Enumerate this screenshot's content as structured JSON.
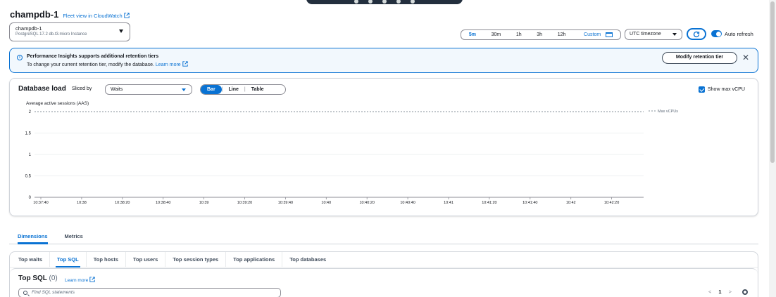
{
  "header": {
    "db_title": "champdb-1",
    "fleet_link": "Fleet view in CloudWatch",
    "instance_select": {
      "name": "champdb-1",
      "meta": "PostgreSQL  17.2  db.t3.micro  Instance"
    }
  },
  "time_range": {
    "options": [
      "5m",
      "30m",
      "1h",
      "3h",
      "12h"
    ],
    "selected": "5m",
    "custom_label": "Custom",
    "timezone": "UTC timezone",
    "auto_refresh_label": "Auto refresh",
    "auto_refresh_on": true
  },
  "alert": {
    "title": "Performance Insights supports additional retention tiers",
    "body": "To change your current retention tier, modify the database.",
    "learn_more": "Learn more",
    "button": "Modify retention tier",
    "close": "✕"
  },
  "load_panel": {
    "title": "Database load",
    "sliced_label": "Sliced by",
    "sliced_value": "Waits",
    "view_options": [
      "Bar",
      "Line",
      "Table"
    ],
    "view_selected": "Bar",
    "show_max_vcpu_label": "Show max vCPU",
    "show_max_vcpu_checked": true
  },
  "chart_data": {
    "type": "bar",
    "ylabel": "Average active sessions (AAS)",
    "ylim": [
      0,
      2
    ],
    "yticks": [
      "0",
      "0.5",
      "1",
      "1.5",
      "2"
    ],
    "categories": [
      "10:37:40",
      "10:38",
      "10:38:20",
      "10:38:40",
      "10:39",
      "10:39:20",
      "10:39:40",
      "10:40",
      "10:40:20",
      "10:40:40",
      "10:41",
      "10:41:20",
      "10:41:40",
      "10:42",
      "10:42:20"
    ],
    "series": [],
    "max_vcpu": 2,
    "legend": [
      {
        "name": "Max vCPUs",
        "style": "dashed"
      }
    ],
    "legend_position": "top-right",
    "grid": true
  },
  "main_tabs": [
    "Dimensions",
    "Metrics"
  ],
  "main_tab_active": 0,
  "sub_tabs": [
    "Top waits",
    "Top SQL",
    "Top hosts",
    "Top users",
    "Top session types",
    "Top applications",
    "Top databases"
  ],
  "sub_tab_active": 1,
  "top_sql": {
    "title": "Top SQL",
    "count": "(0)",
    "learn_more": "Learn more",
    "search_placeholder": "Find SQL statements",
    "page": "1",
    "prev": "<",
    "next": ">"
  }
}
